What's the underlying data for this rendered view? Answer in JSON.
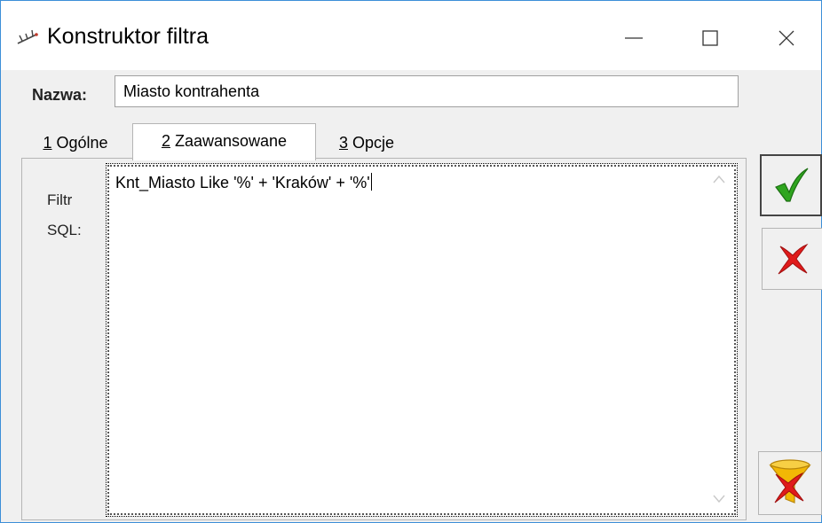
{
  "window": {
    "title": "Konstruktor filtra",
    "controls": {
      "minimize_icon": "minimize-icon",
      "maximize_icon": "maximize-icon",
      "close_icon": "close-icon"
    }
  },
  "form": {
    "name_label": "Nazwa:",
    "name_value": "Miasto kontrahenta"
  },
  "tabs": [
    {
      "mnemonic": "1",
      "label": " Ogólne",
      "active": false
    },
    {
      "mnemonic": "2",
      "label": " Zaawansowane",
      "active": true
    },
    {
      "mnemonic": "3",
      "label": " Opcje",
      "active": false
    }
  ],
  "advanced": {
    "filter_label": "Filtr SQL:",
    "sql_text": "Knt_Miasto Like '%' + 'Kraków' + '%'"
  },
  "actions": {
    "ok_icon": "checkmark-icon",
    "cancel_icon": "cross-icon",
    "clear_filter_icon": "funnel-clear-icon"
  },
  "colors": {
    "accent_border": "#3c8fd8",
    "ok_green": "#2fa51f",
    "cancel_red": "#e01b1b",
    "funnel_yellow": "#f2b705"
  }
}
